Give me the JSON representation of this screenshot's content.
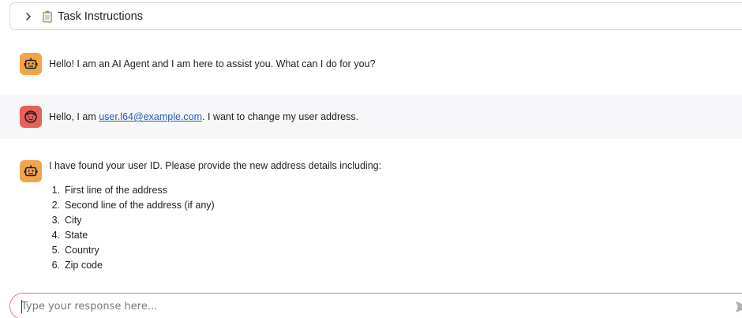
{
  "task": {
    "title": "Task Instructions"
  },
  "messages": [
    {
      "role": "agent",
      "text": "Hello! I am an AI Agent and I am here to assist you. What can I do for you?"
    },
    {
      "role": "user",
      "prefix": "Hello, I am ",
      "email": "user.l64@example.com",
      "suffix": ". I want to change my user address."
    },
    {
      "role": "agent",
      "text": "I have found your user ID. Please provide the new address details including:",
      "list": [
        {
          "num": "1.",
          "text": "First line of the address"
        },
        {
          "num": "2.",
          "text": "Second line of the address (if any)"
        },
        {
          "num": "3.",
          "text": "City"
        },
        {
          "num": "4.",
          "text": "State"
        },
        {
          "num": "5.",
          "text": "Country"
        },
        {
          "num": "6.",
          "text": "Zip code"
        }
      ]
    }
  ],
  "composer": {
    "placeholder": "Type your response here..."
  },
  "colors": {
    "agent_avatar": "#f0a54a",
    "user_avatar": "#e8605b",
    "link": "#2a5db0",
    "input_border": "#e07a7a"
  },
  "icons": {
    "expand": "chevron-right-icon",
    "task": "clipboard-icon",
    "agent": "robot-icon",
    "user": "user-face-icon",
    "send": "send-icon"
  }
}
